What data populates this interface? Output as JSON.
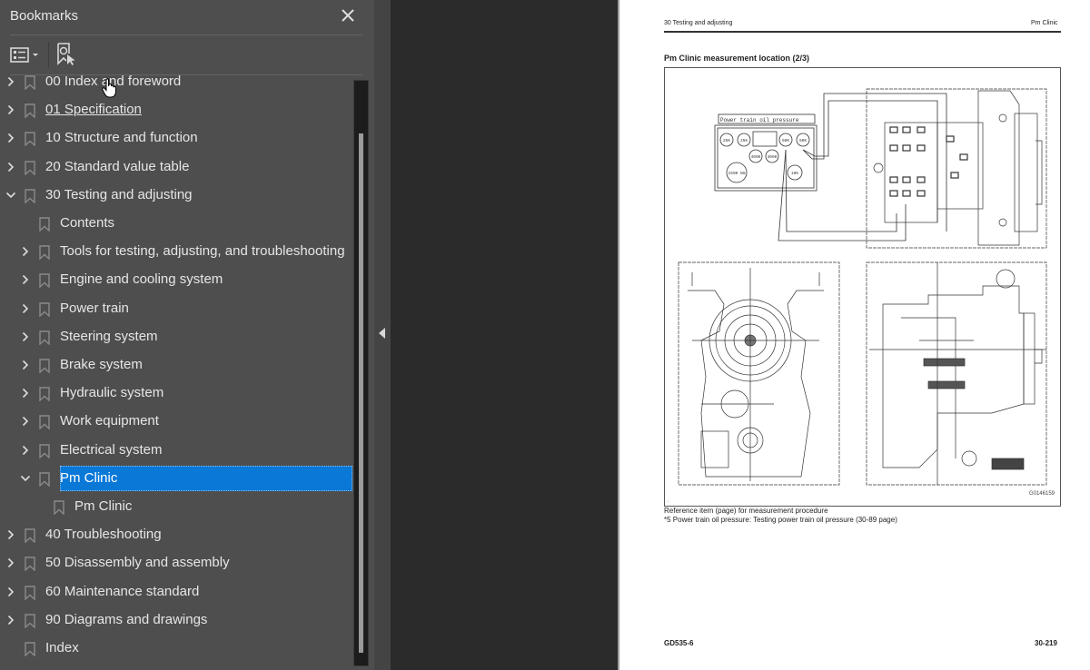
{
  "bookmarks_panel": {
    "title": "Bookmarks",
    "close_icon": "close-icon",
    "toolbar": {
      "options_icon": "list-options-icon",
      "find_bookmark_icon": "find-current-bookmark-icon"
    },
    "items": [
      {
        "label": "00 Index and foreword",
        "level": 0,
        "expander": "collapsed"
      },
      {
        "label": "01 Specification",
        "level": 0,
        "expander": "collapsed",
        "underlined": true
      },
      {
        "label": "10 Structure and function",
        "level": 0,
        "expander": "collapsed"
      },
      {
        "label": "20 Standard value table",
        "level": 0,
        "expander": "collapsed"
      },
      {
        "label": "30 Testing and adjusting",
        "level": 0,
        "expander": "expanded"
      },
      {
        "label": "Contents",
        "level": 1,
        "expander": "none"
      },
      {
        "label": "Tools for testing, adjusting, and troubleshooting",
        "level": 1,
        "expander": "collapsed"
      },
      {
        "label": "Engine and cooling system",
        "level": 1,
        "expander": "collapsed"
      },
      {
        "label": "Power train",
        "level": 1,
        "expander": "collapsed"
      },
      {
        "label": "Steering system",
        "level": 1,
        "expander": "collapsed"
      },
      {
        "label": "Brake system",
        "level": 1,
        "expander": "collapsed"
      },
      {
        "label": "Hydraulic system",
        "level": 1,
        "expander": "collapsed"
      },
      {
        "label": "Work equipment",
        "level": 1,
        "expander": "collapsed"
      },
      {
        "label": "Electrical system",
        "level": 1,
        "expander": "collapsed"
      },
      {
        "label": "Pm Clinic",
        "level": 1,
        "expander": "expanded",
        "selected": true
      },
      {
        "label": "Pm Clinic",
        "level": 2,
        "expander": "none"
      },
      {
        "label": "40 Troubleshooting",
        "level": 0,
        "expander": "collapsed"
      },
      {
        "label": "50 Disassembly and assembly",
        "level": 0,
        "expander": "collapsed"
      },
      {
        "label": "60 Maintenance standard",
        "level": 0,
        "expander": "collapsed"
      },
      {
        "label": "90 Diagrams and drawings",
        "level": 0,
        "expander": "collapsed"
      },
      {
        "label": "Index",
        "level": 0,
        "expander": "none"
      }
    ],
    "selection_color": "#0a78d7"
  },
  "page": {
    "header_left": "30 Testing and adjusting",
    "header_right": "Pm Clinic",
    "title": "Pm Clinic measurement location (2/3)",
    "figure": {
      "panel_title": "Power train oil pressure",
      "gauges": [
        "25K",
        "25K",
        "60K",
        "60K",
        "400K",
        "400K",
        "1500 Nm",
        "10K"
      ],
      "figure_id": "G0146159"
    },
    "reference_heading": "Reference item (page) for measurement procedure",
    "reference_item": "*5 Power train oil pressure: Testing power train oil pressure (30-89 page)",
    "footer_left": "GD535-6",
    "footer_right": "30-219"
  }
}
